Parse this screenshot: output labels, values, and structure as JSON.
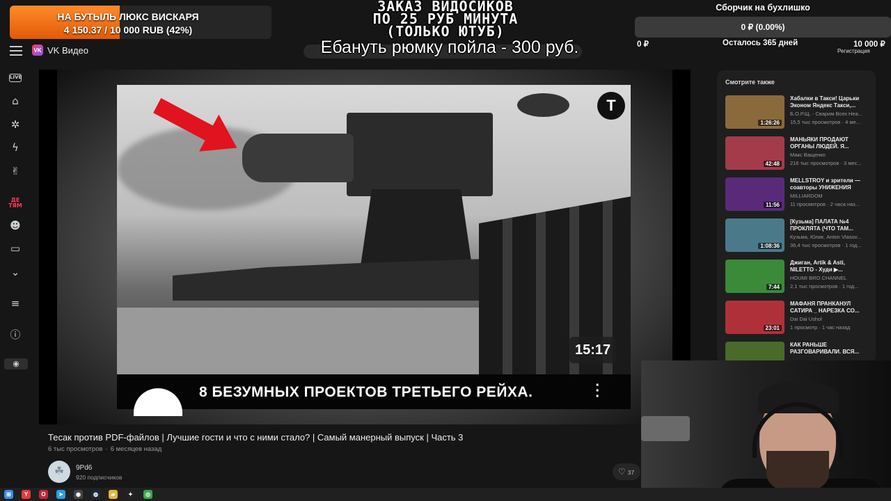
{
  "app": {
    "name": "VK Видео",
    "logo_letters": "VK"
  },
  "sidebar": {
    "items": [
      {
        "name": "live",
        "label": "LIVE"
      },
      {
        "name": "home",
        "glyph": "⌂"
      },
      {
        "name": "explore",
        "glyph": "✲"
      },
      {
        "name": "shorts",
        "glyph": "ϟ"
      },
      {
        "name": "clips",
        "glyph": "✌"
      },
      {
        "name": "kids",
        "label": "ДЕ ТЯМ"
      },
      {
        "name": "games",
        "glyph": "☻"
      },
      {
        "name": "tv",
        "glyph": "▭"
      },
      {
        "name": "more",
        "glyph": "⌄"
      },
      {
        "name": "playlists",
        "glyph": "≡"
      },
      {
        "name": "info",
        "glyph": "ⓘ"
      },
      {
        "name": "profile",
        "glyph": "◉"
      }
    ]
  },
  "player": {
    "duration": "15:17",
    "inner_title": "8 БЕЗУМНЫХ ПРОЕКТОВ ТРЕТЬЕГО РЕЙХА.",
    "channel_logo": "T",
    "colors": {
      "arrow": "#e1131e"
    }
  },
  "video": {
    "title": "Тесак против PDF-файлов | Лучшие гости и что с ними стало? | Самый манерный выпуск | Часть 3",
    "views": "6 тыс просмотров",
    "age": "6 месяцев назад",
    "channel_name": "9Pd6",
    "subscribers": "920 подписчиков",
    "likes": "37"
  },
  "recommendations": {
    "title": "Смотрите также",
    "items": [
      {
        "title": "Хабалки в Такси! Царьки Эконом Яндекс Такси,...",
        "channel": "Б.О.Р.Щ. - Сварим Всех Неа...",
        "meta": "15,5 тыс просмотров · 4 ме...",
        "duration": "1:26:26",
        "thumb": "#8a6a3a"
      },
      {
        "title": "МАНЬЯКИ ПРОДАЮТ ОРГАНЫ ЛЮДЕЙ. Я...",
        "channel": "Макс Ващенко",
        "meta": "216 тыс просмотров · 3 мес...",
        "duration": "42:48",
        "thumb": "#a33b4a"
      },
      {
        "title": "MELLSTROY и зрители — соавторы УНИЖЕНИЯ",
        "channel": "MILLIARDOM",
        "meta": "11 просмотров · 2 часа наз...",
        "duration": "11:56",
        "thumb": "#5a2a7a"
      },
      {
        "title": "[Кузьма] ПАЛАТА №4 ПРОКЛЯТА (ЧТО ТАМ...",
        "channel": "Кузьма, Юлик, Anton Vlasov...",
        "meta": "36,4 тыс просмотров · 1 год...",
        "duration": "1:08:36",
        "thumb": "#4a7a8a"
      },
      {
        "title": "Джиган, Artik & Asti, NILETTO - Худи ▶...",
        "channel": "HOUMI BRO CHANNEL",
        "meta": "2,1 тыс просмотров · 1 год...",
        "duration": "7:44",
        "thumb": "#3a8a3a"
      },
      {
        "title": "МАФАНЯ ПРАНКАНУЛ САТИРА _ НАРЕЗКА СО...",
        "channel": "Dai Dai Ushol",
        "meta": "1 просмотр · 1 час назад",
        "duration": "23:01",
        "thumb": "#b0303a"
      },
      {
        "title": "КАК РАНЬШЕ РАЗГОВАРИВАЛИ. ВСЯ...",
        "channel": "",
        "meta": "",
        "duration": "",
        "thumb": "#4a6a2a"
      }
    ]
  },
  "overlays": {
    "goal_left": {
      "title": "НА БУТЫЛЬ ЛЮКС ВИСКАРЯ",
      "progress": "4 150.37 / 10 000 RUB (42%)",
      "fraction": 0.42,
      "color": "#e25b06"
    },
    "order_banner": [
      "ЗАКАЗ ВИДОСИКОВ",
      "ПО 25 РУБ МИНУТА",
      "(ТОЛЬКО ЮТУБ)"
    ],
    "rum_text": "Ебануть рюмку пойла - 300 руб.",
    "goal_right": {
      "title": "Сборчик на бухлишко",
      "percent_text": "0 ₽ (0.00%)",
      "fraction": 0.0,
      "min": "0 ₽",
      "days_left": "Осталось 365 дней",
      "max": "10 000 ₽",
      "register": "Регистрация"
    }
  },
  "taskbar": {
    "icons": [
      {
        "name": "windows-start",
        "glyph": "⊞",
        "color": "#3a8ee6"
      },
      {
        "name": "yandex-browser",
        "glyph": "Y",
        "color": "#e63a3a"
      },
      {
        "name": "opera-gx",
        "glyph": "O",
        "color": "#c0263a"
      },
      {
        "name": "telegram",
        "glyph": "➤",
        "color": "#2a9ee6"
      },
      {
        "name": "obs",
        "glyph": "◉",
        "color": "#444"
      },
      {
        "name": "steam",
        "glyph": "◍",
        "color": "#1b2838"
      },
      {
        "name": "file-explorer",
        "glyph": "▰",
        "color": "#e6b63a"
      },
      {
        "name": "app-yellow",
        "glyph": "✦",
        "color": "#222"
      },
      {
        "name": "chrome",
        "glyph": "◎",
        "color": "#3aa64a"
      }
    ]
  }
}
